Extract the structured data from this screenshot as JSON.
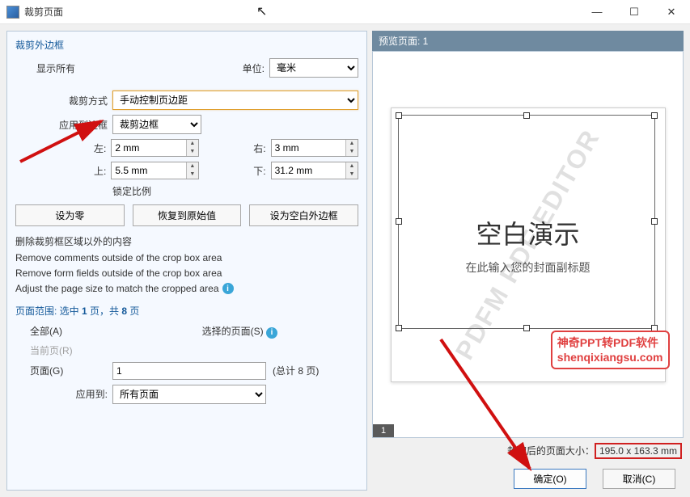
{
  "window": {
    "title": "裁剪页面"
  },
  "left": {
    "group_title": "裁剪外边框",
    "show_all": "显示所有",
    "unit_label": "单位:",
    "unit_value": "毫米",
    "crop_mode_label": "裁剪方式",
    "crop_mode_value": "手动控制页边距",
    "apply_border_label": "应用到边框",
    "apply_border_value": "裁剪边框",
    "left_label": "左:",
    "left_value": "2 mm",
    "right_label": "右:",
    "right_value": "3 mm",
    "top_label": "上:",
    "top_value": "5.5 mm",
    "bottom_label": "下:",
    "bottom_value": "31.2 mm",
    "lock_ratio": "锁定比例",
    "btn_zero": "设为零",
    "btn_reset": "恢复到原始值",
    "btn_blank": "设为空白外边框",
    "remove_head": "删除裁剪框区域以外的内容",
    "remove_comments": "Remove comments outside of the crop box area",
    "remove_fields": "Remove form fields outside of the crop box area",
    "adjust_size": "Adjust the page size to match the cropped area",
    "range_head_prefix": "页面范围: 选中 ",
    "range_head_sel": "1",
    "range_head_mid": " 页，共 ",
    "range_head_total": "8",
    "range_head_suffix": " 页",
    "all_label": "全部(A)",
    "selected_label": "选择的页面(S)",
    "current_label": "当前页(R)",
    "page_label": "页面(G)",
    "page_value": "1",
    "page_total": "(总计 8 页)",
    "apply_to_label": "应用到:",
    "apply_to_value": "所有页面"
  },
  "right": {
    "preview_title": "预览页面: 1",
    "watermark": "PDFM PDF EDITOR",
    "thumb_title": "空白演示",
    "thumb_sub": "在此输入您的封面副标题",
    "brand1": "神奇PPT转PDF软件",
    "brand2": "shenqixiangsu.com",
    "page_num": "1",
    "size_label": "裁切后的页面大小：",
    "size_value": "195.0 x 163.3 mm"
  },
  "footer": {
    "ok": "确定(O)",
    "cancel": "取消(C)"
  }
}
